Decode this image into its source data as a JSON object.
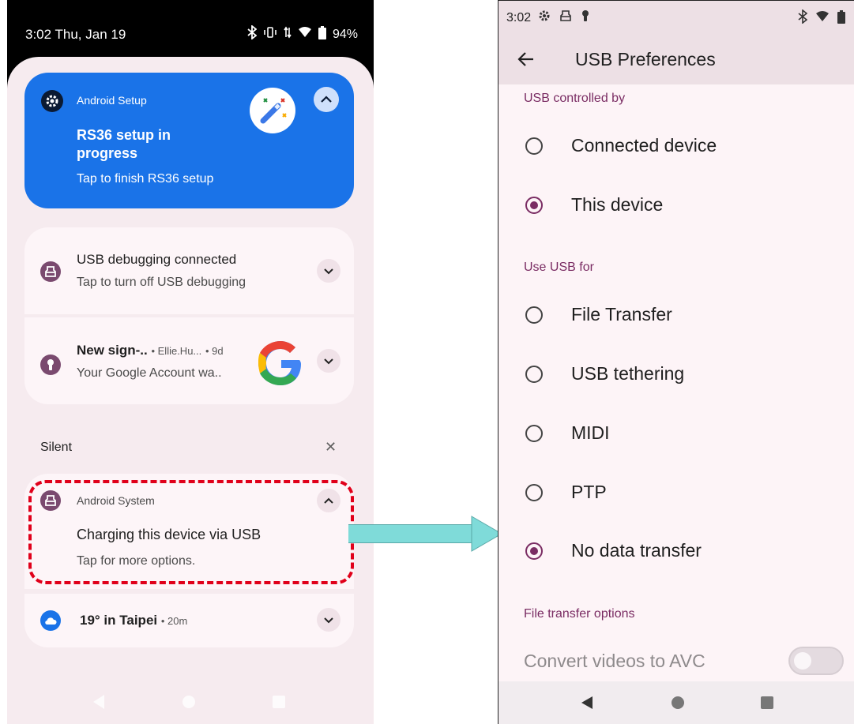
{
  "left": {
    "status_bar": {
      "time": "3:02 Thu, Jan 19",
      "battery": "94%"
    },
    "setup_notification": {
      "app_name": "Android Setup",
      "title": "RS36 setup in progress",
      "subtitle": "Tap to finish RS36 setup"
    },
    "usb_debug_notification": {
      "title": "USB debugging connected",
      "subtitle": "Tap to turn off USB debugging"
    },
    "google_notification": {
      "title": "New sign-..",
      "account": "• Ellie.Hu...",
      "age": "• 9d",
      "subtitle": "Your Google Account wa.."
    },
    "silent_section": {
      "label": "Silent",
      "close": "✕"
    },
    "system_notification": {
      "app_name": "Android System",
      "title": "Charging this device via USB",
      "subtitle": "Tap for more options."
    },
    "weather_notification": {
      "title": "19° in Taipei",
      "age": "• 20m"
    }
  },
  "right": {
    "status_bar": {
      "time": "3:02"
    },
    "app_bar": {
      "title": "USB Preferences"
    },
    "usb_controlled_by": {
      "label": "USB controlled by",
      "options": [
        {
          "label": "Connected device",
          "checked": false
        },
        {
          "label": "This device",
          "checked": true
        }
      ]
    },
    "use_usb_for": {
      "label": "Use USB for",
      "options": [
        {
          "label": "File Transfer",
          "checked": false
        },
        {
          "label": "USB tethering",
          "checked": false
        },
        {
          "label": "MIDI",
          "checked": false
        },
        {
          "label": "PTP",
          "checked": false
        },
        {
          "label": "No data transfer",
          "checked": true
        }
      ]
    },
    "file_transfer_options": {
      "label": "File transfer options",
      "convert_videos": "Convert videos to AVC",
      "convert_videos_enabled": false
    }
  },
  "colors": {
    "accent": "#7a2c63",
    "setup_card": "#1a73e8",
    "highlight": "#e0001a",
    "arrow": "#7fdbd9"
  }
}
